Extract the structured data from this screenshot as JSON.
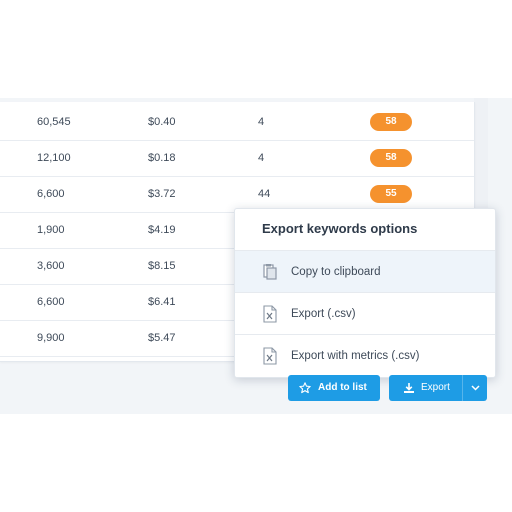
{
  "table": {
    "rows": [
      {
        "volume": "60,545",
        "cpc": "$0.40",
        "competition": "4",
        "kd": "58"
      },
      {
        "volume": "12,100",
        "cpc": "$0.18",
        "competition": "4",
        "kd": "58"
      },
      {
        "volume": "6,600",
        "cpc": "$3.72",
        "competition": "44",
        "kd": "55"
      },
      {
        "volume": "1,900",
        "cpc": "$4.19",
        "competition": "",
        "kd": ""
      },
      {
        "volume": "3,600",
        "cpc": "$8.15",
        "competition": "",
        "kd": ""
      },
      {
        "volume": "6,600",
        "cpc": "$6.41",
        "competition": "",
        "kd": ""
      },
      {
        "volume": "9,900",
        "cpc": "$5.47",
        "competition": "",
        "kd": ""
      }
    ]
  },
  "export_menu": {
    "title": "Export keywords options",
    "items": [
      {
        "label": "Copy to clipboard",
        "icon": "clipboard-icon"
      },
      {
        "label": "Export (.csv)",
        "icon": "csv-file-icon"
      },
      {
        "label": "Export with metrics (.csv)",
        "icon": "csv-file-icon"
      }
    ]
  },
  "actions": {
    "add_to_list": "Add to list",
    "export": "Export"
  },
  "colors": {
    "badge": "#f5922e",
    "button": "#1e9ce5",
    "menu_active": "#eef4fa"
  }
}
